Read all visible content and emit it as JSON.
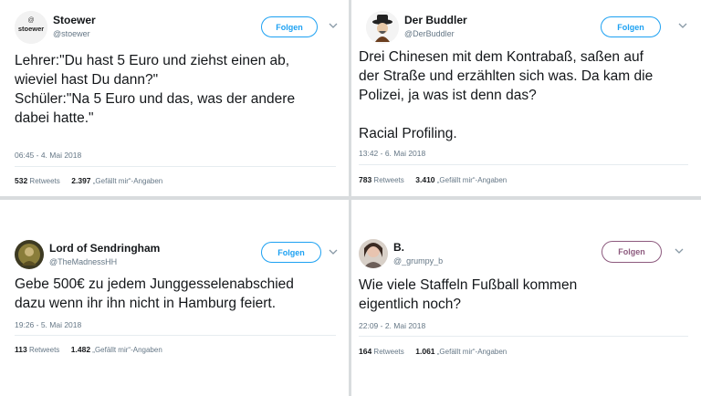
{
  "tweets": [
    {
      "name": "Stoewer",
      "handle": "@stoewer",
      "avatar_text": "stoewer",
      "follow": "Folgen",
      "text": "Lehrer:\"Du hast 5 Euro und ziehst einen ab,\nwieviel hast Du dann?\"\nSchüler:\"Na 5 Euro und das, was der andere\ndabei hatte.\"",
      "time": "06:45 - 4. Mai 2018",
      "retweets": "532",
      "retweets_label": "Retweets",
      "likes": "2.397",
      "likes_label": "„Gefällt mir“-Angaben"
    },
    {
      "name": "Der Buddler",
      "handle": "@DerBuddler",
      "follow": "Folgen",
      "text": "Drei Chinesen mit dem Kontrabaß, saßen auf\nder Straße und erzählten sich was. Da kam die\nPolizei, ja was ist denn das?\n\nRacial Profiling.",
      "time": "13:42 - 6. Mai 2018",
      "retweets": "783",
      "retweets_label": "Retweets",
      "likes": "3.410",
      "likes_label": "„Gefällt mir“-Angaben"
    },
    {
      "name": "Lord of Sendringham",
      "handle": "@TheMadnessHH",
      "follow": "Folgen",
      "text": "Gebe 500€ zu jedem Junggesselenabschied\ndazu wenn ihr ihn nicht in Hamburg feiert.",
      "time": "19:26 - 5. Mai 2018",
      "retweets": "113",
      "retweets_label": "Retweets",
      "likes": "1.482",
      "likes_label": "„Gefällt mir“-Angaben"
    },
    {
      "name": "B.",
      "handle": "@_grumpy_b",
      "follow": "Folgen",
      "text": "Wie viele Staffeln Fußball kommen\neigentlich noch?",
      "time": "22:09 - 2. Mai 2018",
      "retweets": "164",
      "retweets_label": "Retweets",
      "likes": "1.061",
      "likes_label": "„Gefällt mir“-Angaben"
    }
  ],
  "colors": {
    "follow_blue": "#1da1f2",
    "follow_purple": "#8d5a7e",
    "muted": "#657786",
    "separator": "#d9dcde"
  },
  "icons": {
    "menu": "chevron-down-icon"
  }
}
